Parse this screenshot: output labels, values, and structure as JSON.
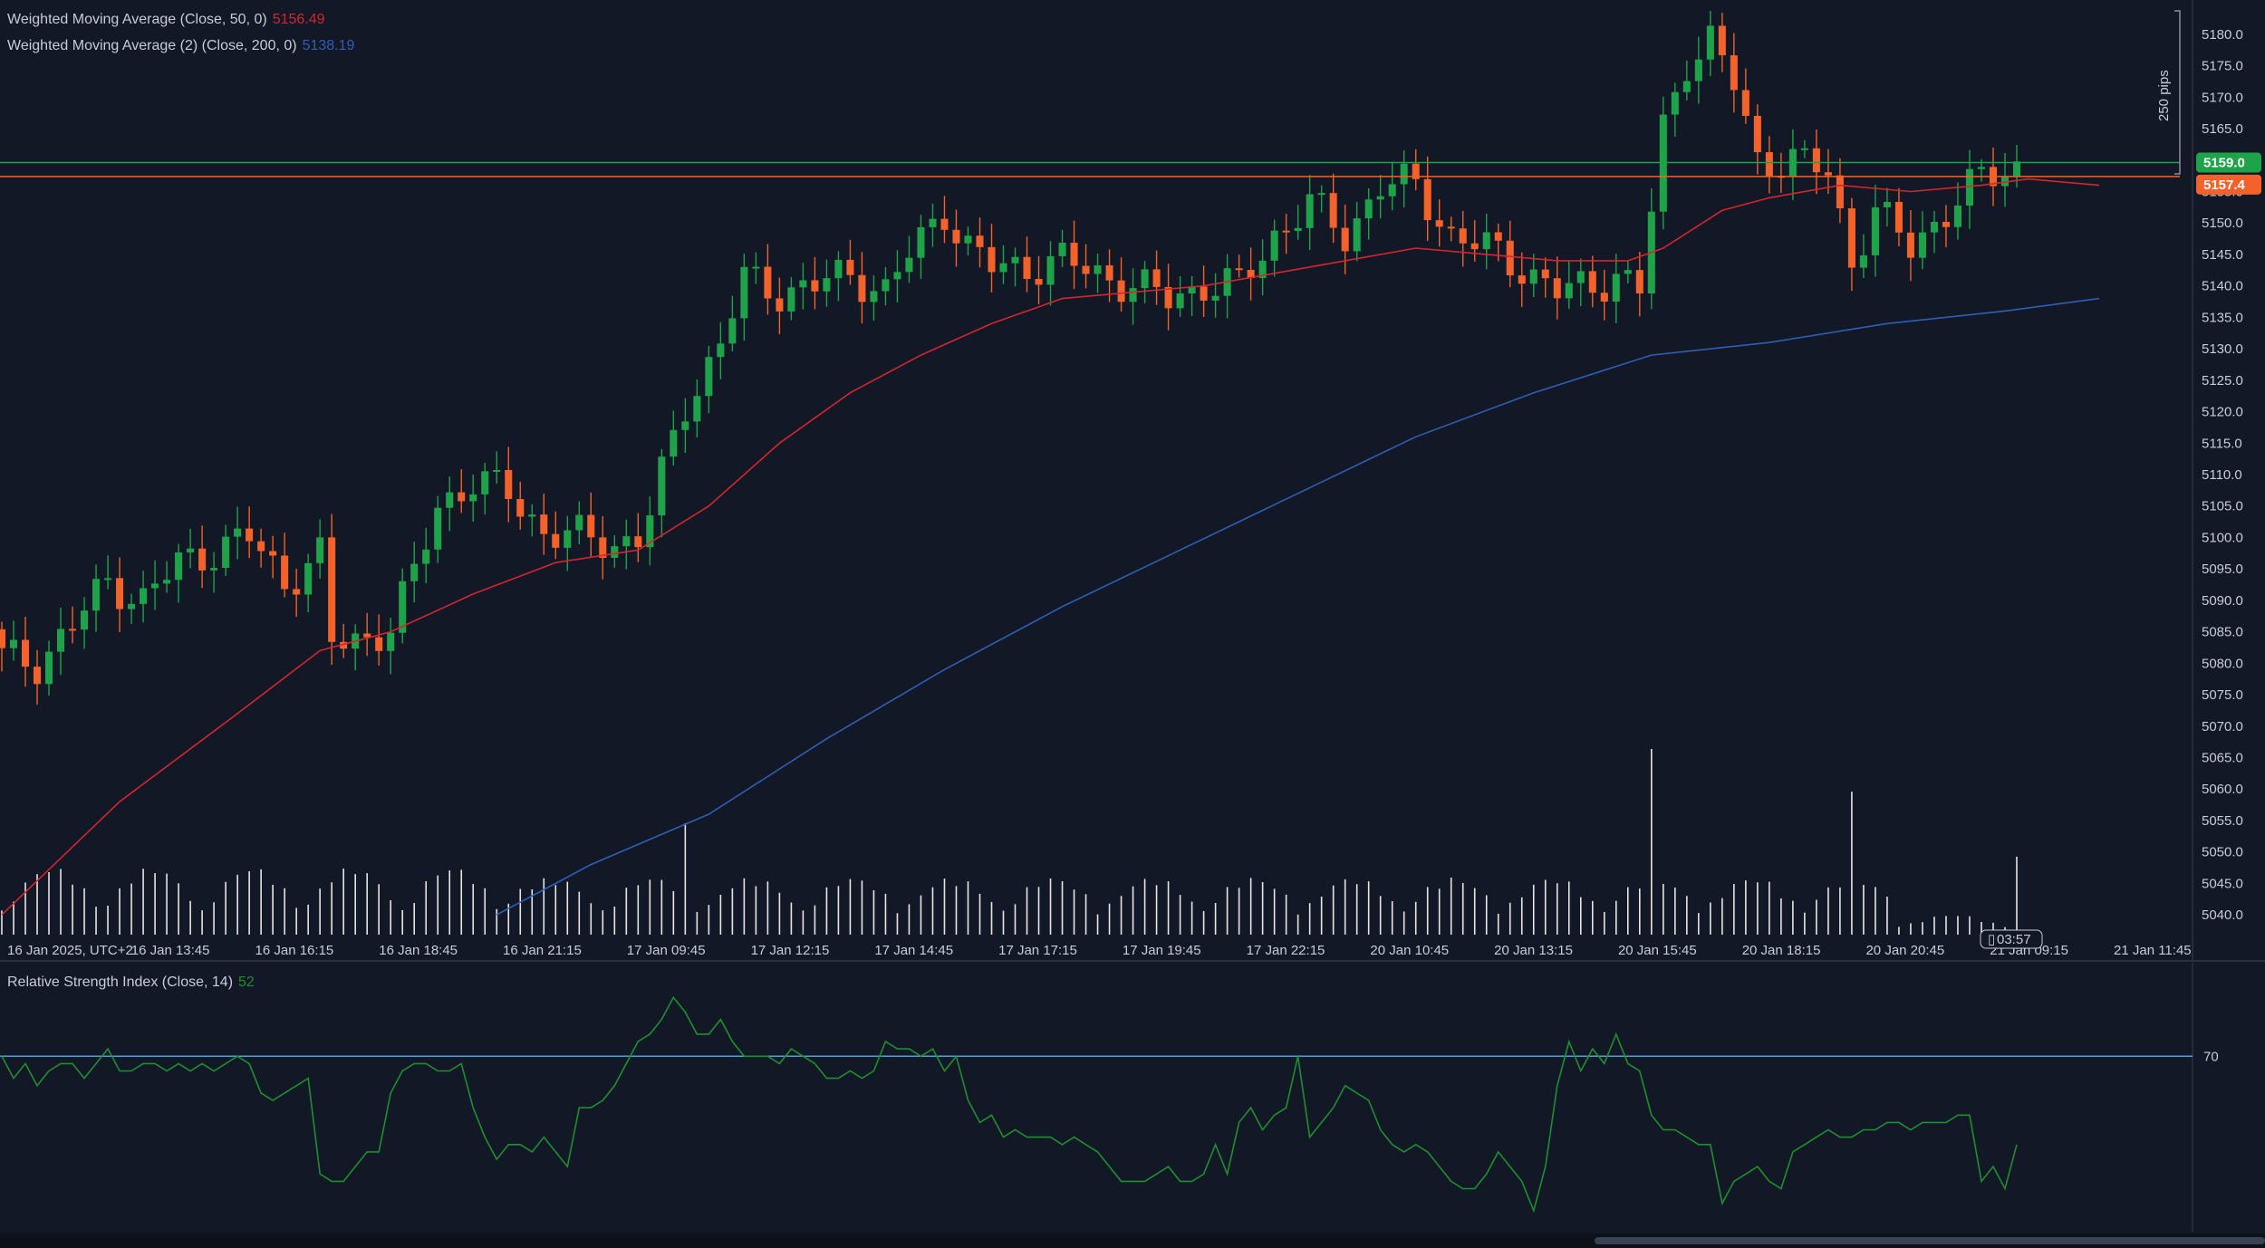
{
  "legend": {
    "wma1": {
      "label": "Weighted Moving Average (Close, 50, 0)",
      "value": "5156.49",
      "color": "#d3262e"
    },
    "wma2": {
      "label": "Weighted Moving Average (2) (Close, 200, 0)",
      "value": "5138.19",
      "color": "#2f5fb3"
    },
    "rsi": {
      "label": "Relative Strength Index (Close, 14)",
      "value": "52",
      "color": "#1e8f2f"
    }
  },
  "colors": {
    "background": "#121826",
    "up": "#1fa34a",
    "down": "#f2622a",
    "grid_axis": "#3a4150",
    "text": "#c8ccd6",
    "volume": "#e6e6e6",
    "hline_green": "#1fa34a",
    "hline_orange": "#f2622a",
    "rsi_level": "#4f9fd6"
  },
  "price_badges": [
    {
      "text": "5159.0",
      "color": "#1fa34a",
      "value": 5159.6
    },
    {
      "text": "5157.4",
      "color": "#f2622a",
      "value": 5157.4
    }
  ],
  "pips_label": "250 pips",
  "countdown": "03:57",
  "rsi_level_label": "70",
  "chart_data": [
    {
      "type": "candlestick",
      "ylim": [
        5038,
        5182
      ],
      "y_ticks": [
        "5180.0",
        "5175.0",
        "5170.0",
        "5165.0",
        "5160.0",
        "5155.0",
        "5150.0",
        "5145.0",
        "5140.0",
        "5135.0",
        "5130.0",
        "5125.0",
        "5120.0",
        "5115.0",
        "5110.0",
        "5105.0",
        "5100.0",
        "5095.0",
        "5090.0",
        "5085.0",
        "5080.0",
        "5075.0",
        "5070.0",
        "5065.0",
        "5060.0",
        "5055.0",
        "5050.0",
        "5045.0",
        "5040.0"
      ],
      "x_tick_labels": [
        "16 Jan 2025, UTC+2",
        "16 Jan 13:45",
        "16 Jan 16:15",
        "16 Jan 18:45",
        "16 Jan 21:15",
        "17 Jan 09:45",
        "17 Jan 12:15",
        "17 Jan 14:45",
        "17 Jan 17:15",
        "17 Jan 19:45",
        "17 Jan 22:15",
        "20 Jan 10:45",
        "20 Jan 13:15",
        "20 Jan 15:45",
        "20 Jan 18:15",
        "20 Jan 20:45",
        "21 Jan 09:15",
        "21 Jan 11:45"
      ],
      "horizontal_lines": [
        5159.6,
        5157.4
      ],
      "anchors_close": [
        [
          0,
          5081
        ],
        [
          3,
          5080
        ],
        [
          6,
          5086
        ],
        [
          9,
          5093
        ],
        [
          12,
          5090
        ],
        [
          15,
          5096
        ],
        [
          18,
          5098
        ],
        [
          21,
          5100
        ],
        [
          24,
          5093
        ],
        [
          27,
          5097
        ],
        [
          28,
          5083
        ],
        [
          31,
          5084
        ],
        [
          33,
          5086
        ],
        [
          35,
          5094
        ],
        [
          37,
          5105
        ],
        [
          40,
          5109
        ],
        [
          43,
          5107
        ],
        [
          46,
          5101
        ],
        [
          49,
          5100
        ],
        [
          52,
          5099
        ],
        [
          54,
          5100
        ],
        [
          55,
          5104
        ],
        [
          58,
          5121
        ],
        [
          61,
          5131
        ],
        [
          63,
          5141
        ],
        [
          66,
          5139
        ],
        [
          69,
          5140
        ],
        [
          72,
          5142
        ],
        [
          75,
          5139
        ],
        [
          77,
          5145
        ],
        [
          80,
          5152
        ],
        [
          82,
          5146
        ],
        [
          84,
          5143
        ],
        [
          87,
          5143
        ],
        [
          90,
          5144
        ],
        [
          93,
          5142
        ],
        [
          96,
          5140
        ],
        [
          99,
          5138
        ],
        [
          102,
          5140
        ],
        [
          105,
          5140
        ],
        [
          108,
          5148
        ],
        [
          111,
          5153
        ],
        [
          114,
          5148
        ],
        [
          117,
          5156
        ],
        [
          120,
          5156
        ],
        [
          123,
          5148
        ],
        [
          126,
          5146
        ],
        [
          129,
          5143
        ],
        [
          132,
          5139
        ],
        [
          135,
          5140
        ],
        [
          137,
          5142
        ],
        [
          139,
          5139
        ],
        [
          141,
          5165
        ],
        [
          143,
          5176
        ],
        [
          145,
          5179
        ],
        [
          147,
          5172
        ],
        [
          149,
          5160
        ],
        [
          152,
          5160
        ],
        [
          155,
          5158
        ],
        [
          157,
          5144
        ],
        [
          159,
          5152
        ],
        [
          162,
          5146
        ],
        [
          165,
          5152
        ],
        [
          168,
          5157
        ],
        [
          171,
          5159
        ],
        [
          173,
          5160
        ],
        [
          175,
          5149
        ],
        [
          177,
          5151
        ],
        [
          179,
          5154
        ],
        [
          180,
          5160
        ]
      ],
      "wma50_path": [
        [
          0,
          5040
        ],
        [
          10,
          5058
        ],
        [
          20,
          5072
        ],
        [
          27,
          5082
        ],
        [
          33,
          5085
        ],
        [
          40,
          5091
        ],
        [
          47,
          5096
        ],
        [
          54,
          5098
        ],
        [
          60,
          5105
        ],
        [
          66,
          5115
        ],
        [
          72,
          5123
        ],
        [
          78,
          5129
        ],
        [
          84,
          5134
        ],
        [
          90,
          5138
        ],
        [
          96,
          5139
        ],
        [
          102,
          5140
        ],
        [
          108,
          5142
        ],
        [
          114,
          5144
        ],
        [
          120,
          5146
        ],
        [
          126,
          5145
        ],
        [
          132,
          5144
        ],
        [
          138,
          5144
        ],
        [
          141,
          5146
        ],
        [
          146,
          5152
        ],
        [
          150,
          5154
        ],
        [
          156,
          5156
        ],
        [
          162,
          5155
        ],
        [
          168,
          5156
        ],
        [
          172,
          5157
        ],
        [
          178,
          5156
        ]
      ],
      "wma200_path": [
        [
          42,
          5040
        ],
        [
          50,
          5048
        ],
        [
          60,
          5056
        ],
        [
          70,
          5068
        ],
        [
          80,
          5079
        ],
        [
          90,
          5089
        ],
        [
          100,
          5098
        ],
        [
          110,
          5107
        ],
        [
          120,
          5116
        ],
        [
          130,
          5123
        ],
        [
          140,
          5129
        ],
        [
          150,
          5131
        ],
        [
          160,
          5134
        ],
        [
          170,
          5136
        ],
        [
          178,
          5138
        ]
      ],
      "volume_spikes": [
        [
          58,
          0.6
        ],
        [
          140,
          1.0
        ],
        [
          157,
          0.77
        ],
        [
          171,
          0.42
        ]
      ],
      "volume_ylim": [
        0,
        1
      ]
    },
    {
      "type": "line",
      "name": "Relative Strength Index (Close, 14)",
      "level": 70,
      "values": [
        70,
        67,
        69,
        66,
        68,
        69,
        69,
        67,
        69,
        71,
        68,
        68,
        69,
        69,
        68,
        69,
        68,
        69,
        68,
        69,
        70,
        69,
        65,
        64,
        65,
        66,
        67,
        54,
        53,
        53,
        55,
        57,
        57,
        65,
        68,
        69,
        69,
        68,
        68,
        69,
        63,
        59,
        56,
        58,
        58,
        57,
        59,
        57,
        55,
        63,
        63,
        64,
        66,
        69,
        72,
        73,
        75,
        78,
        76,
        73,
        73,
        75,
        72,
        70,
        70,
        70,
        69,
        71,
        70,
        69,
        67,
        67,
        68,
        67,
        68,
        72,
        71,
        71,
        70,
        71,
        68,
        70,
        64,
        61,
        62,
        59,
        60,
        59,
        59,
        59,
        58,
        59,
        58,
        57,
        55,
        53,
        53,
        53,
        54,
        55,
        53,
        53,
        54,
        58,
        54,
        61,
        63,
        60,
        62,
        63,
        70,
        59,
        61,
        63,
        66,
        65,
        64,
        60,
        58,
        57,
        58,
        57,
        55,
        53,
        52,
        52,
        54,
        57,
        55,
        53,
        49,
        55,
        66,
        72,
        68,
        71,
        69,
        73,
        69,
        68,
        62,
        60,
        60,
        59,
        58,
        58,
        50,
        53,
        54,
        55,
        53,
        52,
        57,
        58,
        59,
        60,
        59,
        59,
        60,
        60,
        61,
        61,
        60,
        61,
        61,
        61,
        62,
        62,
        53,
        55,
        52,
        58
      ]
    }
  ]
}
